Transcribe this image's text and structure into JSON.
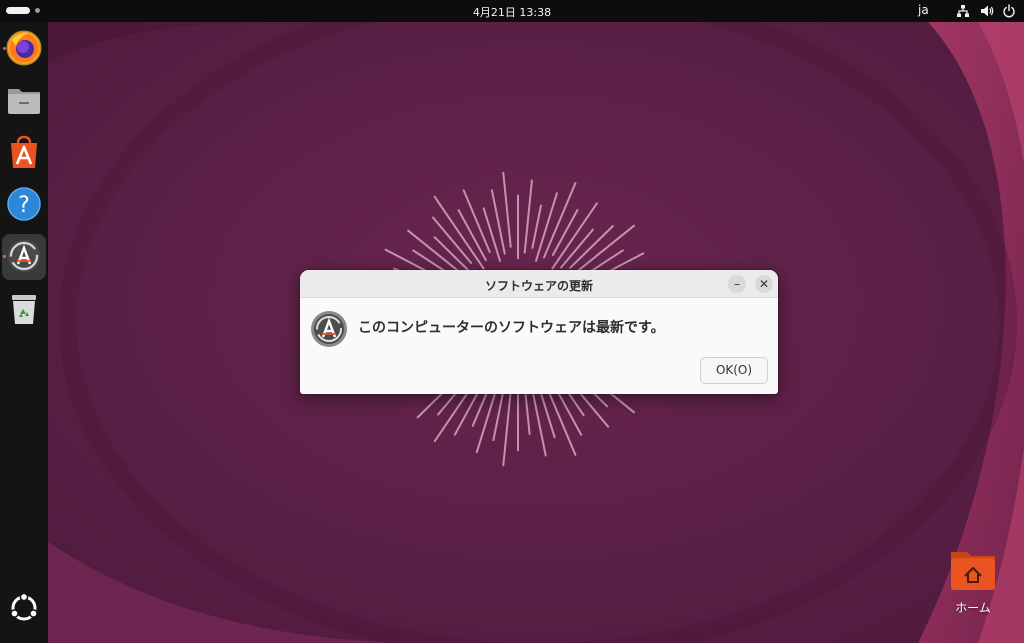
{
  "topbar": {
    "clock": "4月21日  13:38",
    "input_method": "ja"
  },
  "dock": {
    "items": [
      {
        "name": "firefox"
      },
      {
        "name": "files"
      },
      {
        "name": "app-center"
      },
      {
        "name": "help"
      },
      {
        "name": "software-updater",
        "active": true
      },
      {
        "name": "trash"
      }
    ]
  },
  "desktop": {
    "home_label": "ホーム"
  },
  "dialog": {
    "title": "ソフトウェアの更新",
    "message": "このコンピューターのソフトウェアは最新です。",
    "ok_label": "OK(O)",
    "minimize_glyph": "–",
    "close_glyph": "✕"
  },
  "colors": {
    "wallpaper": "#5a1e44",
    "accent": "#e95420",
    "dock": "#141414",
    "topbar": "#0d0d0d"
  }
}
